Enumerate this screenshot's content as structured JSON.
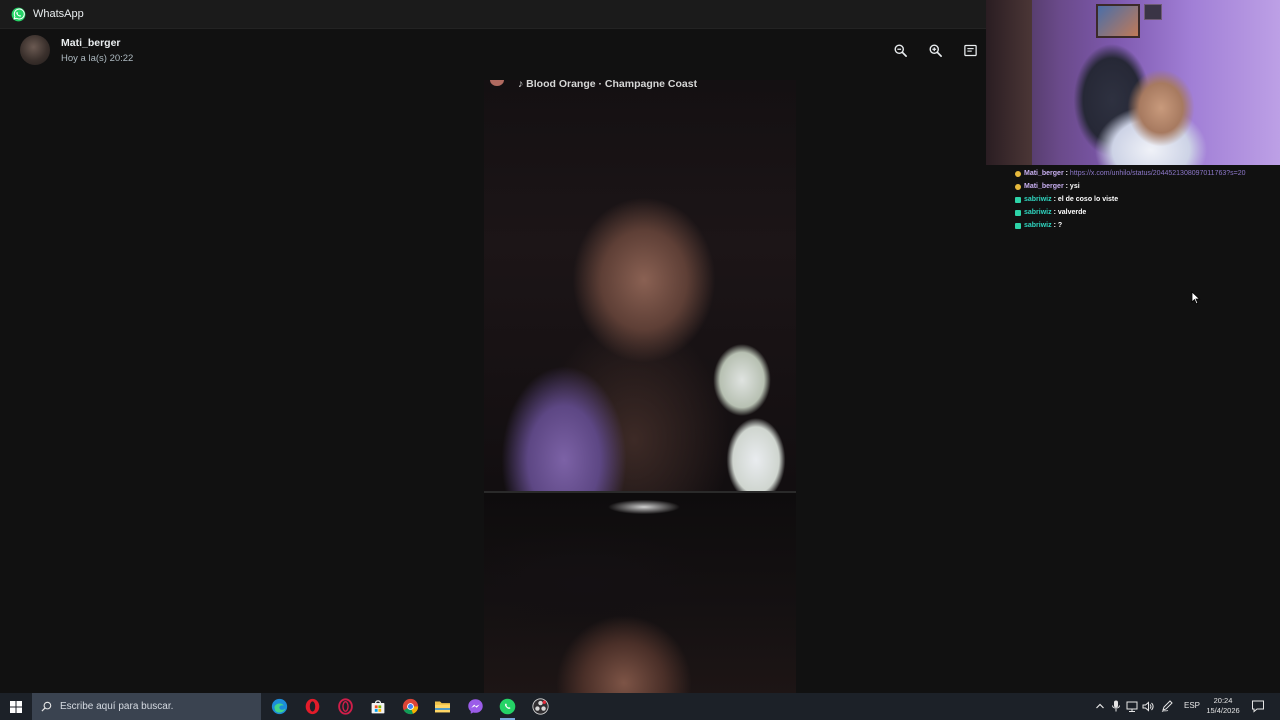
{
  "window": {
    "title": "WhatsApp"
  },
  "viewer": {
    "sender": "Mati_berger",
    "timestamp": "Hoy a la(s) 20:22",
    "song_label": "Blood Orange · Champagne Coast",
    "actions": [
      "zoom-out",
      "zoom-in",
      "view-in-chat"
    ]
  },
  "chat": [
    {
      "badge": "circle",
      "user": "Mati_berger",
      "user_color": "#c9b0f2",
      "text": "https://x.com/unhilo/status/2044521308097011763?s=20",
      "is_link": true
    },
    {
      "badge": "circle",
      "user": "Mati_berger",
      "user_color": "#c9b0f2",
      "text": "ysi",
      "is_link": false
    },
    {
      "badge": "square",
      "user": "sabriwiz",
      "user_color": "#2fd6c0",
      "text": "el de coso lo viste",
      "is_link": false
    },
    {
      "badge": "square",
      "user": "sabriwiz",
      "user_color": "#2fd6c0",
      "text": "valverde",
      "is_link": false
    },
    {
      "badge": "square",
      "user": "sabriwiz",
      "user_color": "#2fd6c0",
      "text": "?",
      "is_link": false
    }
  ],
  "taskbar": {
    "search_placeholder": "Escribe aquí para buscar.",
    "apps": [
      "edge",
      "opera",
      "opera-gx",
      "store",
      "chrome",
      "file-explorer",
      "messenger",
      "whatsapp",
      "obs"
    ],
    "active_app": "whatsapp",
    "language": "ESP",
    "time": "20:24",
    "date": "15/4/2026"
  },
  "colors": {
    "accent": "#25d366",
    "background": "#111111",
    "taskbar": "#1c2128"
  }
}
